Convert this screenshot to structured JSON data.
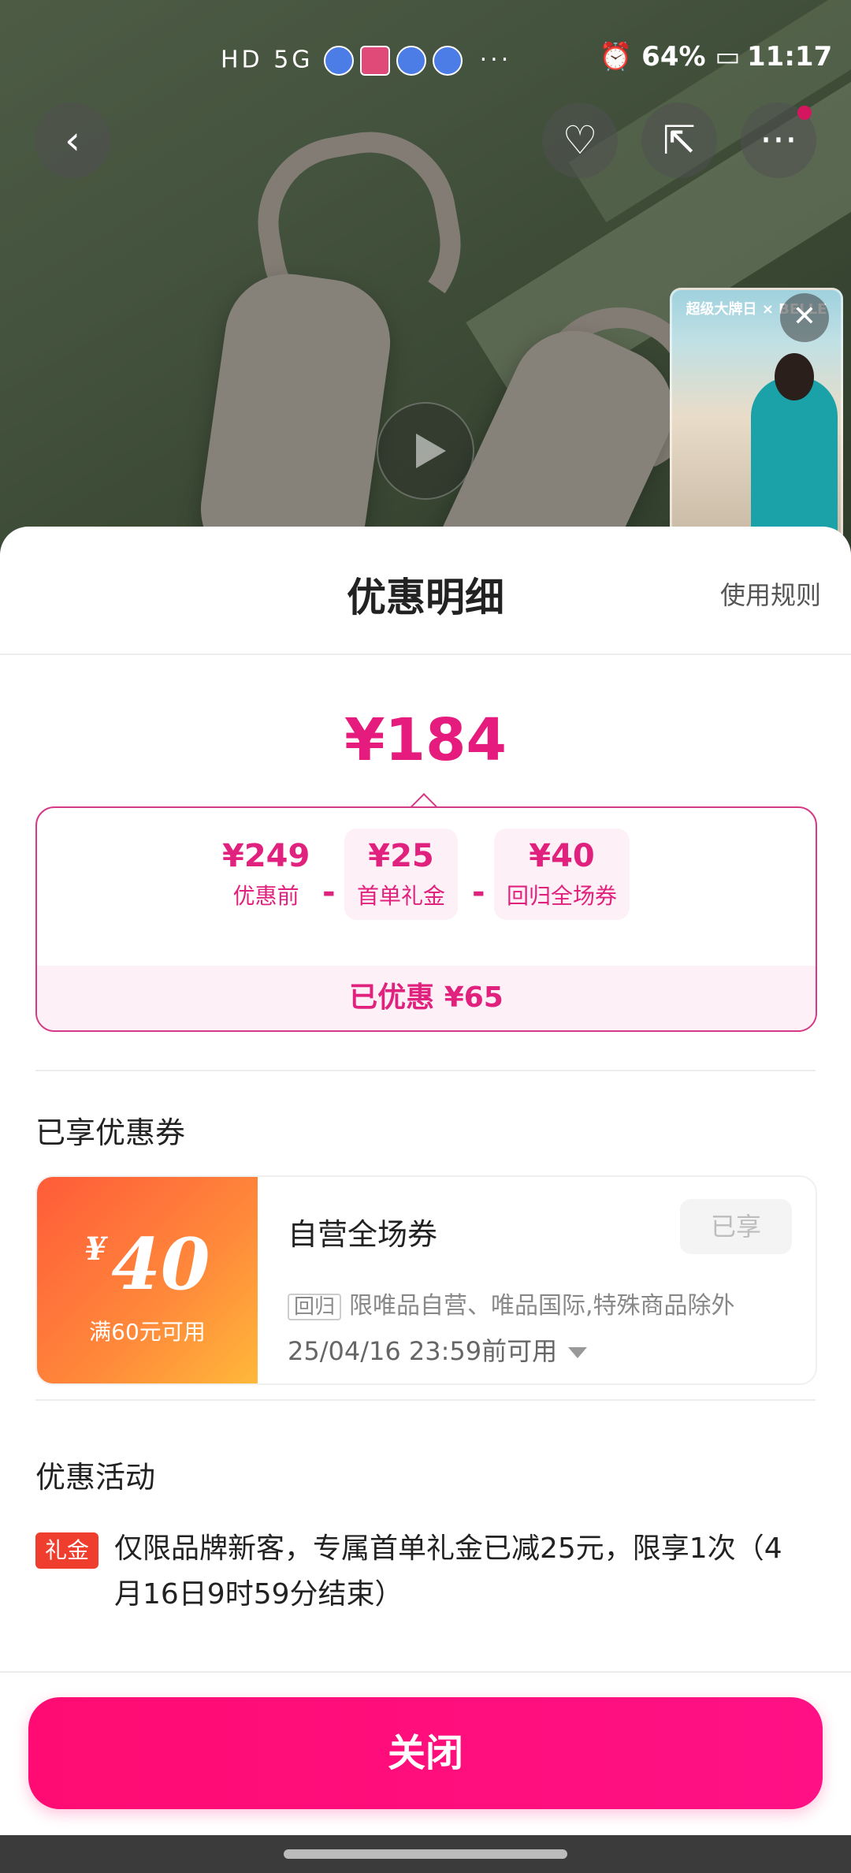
{
  "status_bar": {
    "network": "HD 5G",
    "battery": "64%",
    "time": "11:17",
    "icons": [
      "hd-icon",
      "signal-icon",
      "app-icon",
      "app-icon",
      "music-icon",
      "app-icon",
      "app-icon",
      "more-dots",
      "alarm-icon",
      "battery-icon"
    ]
  },
  "product": {
    "thumb_banner": "超级大牌日 × BELLE"
  },
  "sheet": {
    "title": "优惠明细",
    "rules_link": "使用规则",
    "final_price": "¥184",
    "breakdown": [
      {
        "value": "¥249",
        "label": "优惠前"
      },
      {
        "value": "¥25",
        "label": "首单礼金"
      },
      {
        "value": "¥40",
        "label": "回归全场券"
      }
    ],
    "minus": "-",
    "saved_text": "已优惠 ¥65"
  },
  "coupons": {
    "section_title": "已享优惠券",
    "item": {
      "currency": "¥",
      "amount": "40",
      "condition": "满60元可用",
      "name": "自营全场券",
      "status": "已享",
      "tag": "回归",
      "description": "限唯品自营、唯品国际,特殊商品除外",
      "expire": "25/04/16 23:59前可用"
    }
  },
  "activities": {
    "section_title": "优惠活动",
    "tag": "礼金",
    "text": "仅限品牌新客，专属首单礼金已减25元，限享1次（4月16日9时59分结束）"
  },
  "footer": {
    "close_label": "关闭"
  }
}
